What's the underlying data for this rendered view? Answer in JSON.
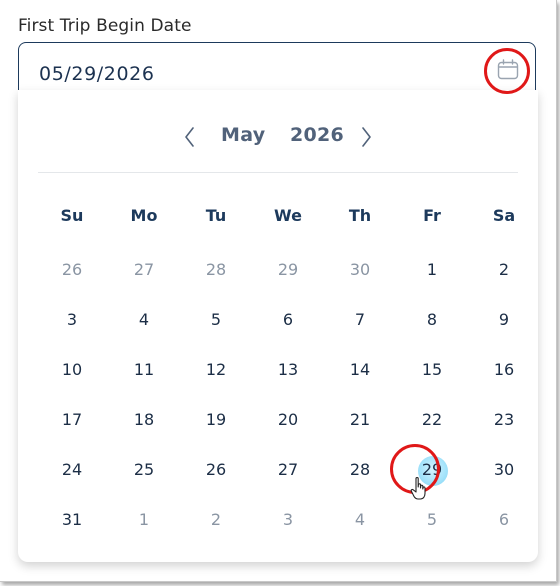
{
  "field": {
    "label": "First Trip Begin Date",
    "value": "05/29/2026"
  },
  "calendar": {
    "month": "May",
    "year": "2026",
    "weekdays": [
      "Su",
      "Mo",
      "Tu",
      "We",
      "Th",
      "Fr",
      "Sa"
    ],
    "weeks": [
      [
        {
          "d": "26",
          "other": true
        },
        {
          "d": "27",
          "other": true
        },
        {
          "d": "28",
          "other": true
        },
        {
          "d": "29",
          "other": true
        },
        {
          "d": "30",
          "other": true
        },
        {
          "d": "1"
        },
        {
          "d": "2"
        }
      ],
      [
        {
          "d": "3"
        },
        {
          "d": "4"
        },
        {
          "d": "5"
        },
        {
          "d": "6"
        },
        {
          "d": "7"
        },
        {
          "d": "8"
        },
        {
          "d": "9"
        }
      ],
      [
        {
          "d": "10"
        },
        {
          "d": "11"
        },
        {
          "d": "12"
        },
        {
          "d": "13"
        },
        {
          "d": "14"
        },
        {
          "d": "15"
        },
        {
          "d": "16"
        }
      ],
      [
        {
          "d": "17"
        },
        {
          "d": "18"
        },
        {
          "d": "19"
        },
        {
          "d": "20"
        },
        {
          "d": "21"
        },
        {
          "d": "22"
        },
        {
          "d": "23"
        }
      ],
      [
        {
          "d": "24"
        },
        {
          "d": "25"
        },
        {
          "d": "26"
        },
        {
          "d": "27"
        },
        {
          "d": "28"
        },
        {
          "d": "29",
          "selected": true
        },
        {
          "d": "30"
        }
      ],
      [
        {
          "d": "31"
        },
        {
          "d": "1",
          "other": true
        },
        {
          "d": "2",
          "other": true
        },
        {
          "d": "3",
          "other": true
        },
        {
          "d": "4",
          "other": true
        },
        {
          "d": "5",
          "other": true
        },
        {
          "d": "6",
          "other": true
        }
      ]
    ],
    "selected_color": "#a6e4fb",
    "highlight_color": "#e01818"
  },
  "icons": {
    "calendar": "calendar-icon",
    "prev": "chevron-left-icon",
    "next": "chevron-right-icon",
    "cursor": "hand-pointer-icon"
  }
}
